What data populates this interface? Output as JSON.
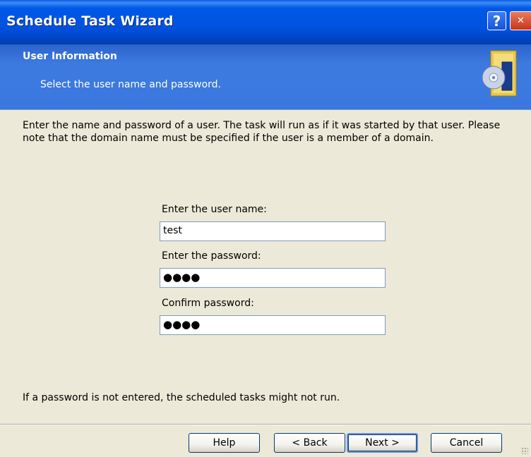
{
  "window": {
    "title": "Schedule Task Wizard",
    "help_button": "?",
    "close_button": "✕"
  },
  "header": {
    "title": "User Information",
    "subtitle": "Select the user name and password."
  },
  "body": {
    "intro": "Enter the name and password of a user. The task will run as if it was started by that user. Please note that the domain name must be specified if the user is a member of a domain.",
    "username_label": "Enter the user name:",
    "username_value": "test",
    "password_label": "Enter the password:",
    "password_value": "●●●●",
    "confirm_label": "Confirm password:",
    "confirm_value": "●●●●",
    "note": "If a password is not entered, the scheduled tasks might not run."
  },
  "buttons": {
    "help": "Help",
    "back": "< Back",
    "next": "Next >",
    "cancel": "Cancel"
  },
  "colors": {
    "titlebar": "#0053e0",
    "header_band": "#3a78df",
    "dialog_bg": "#ece9d8"
  }
}
